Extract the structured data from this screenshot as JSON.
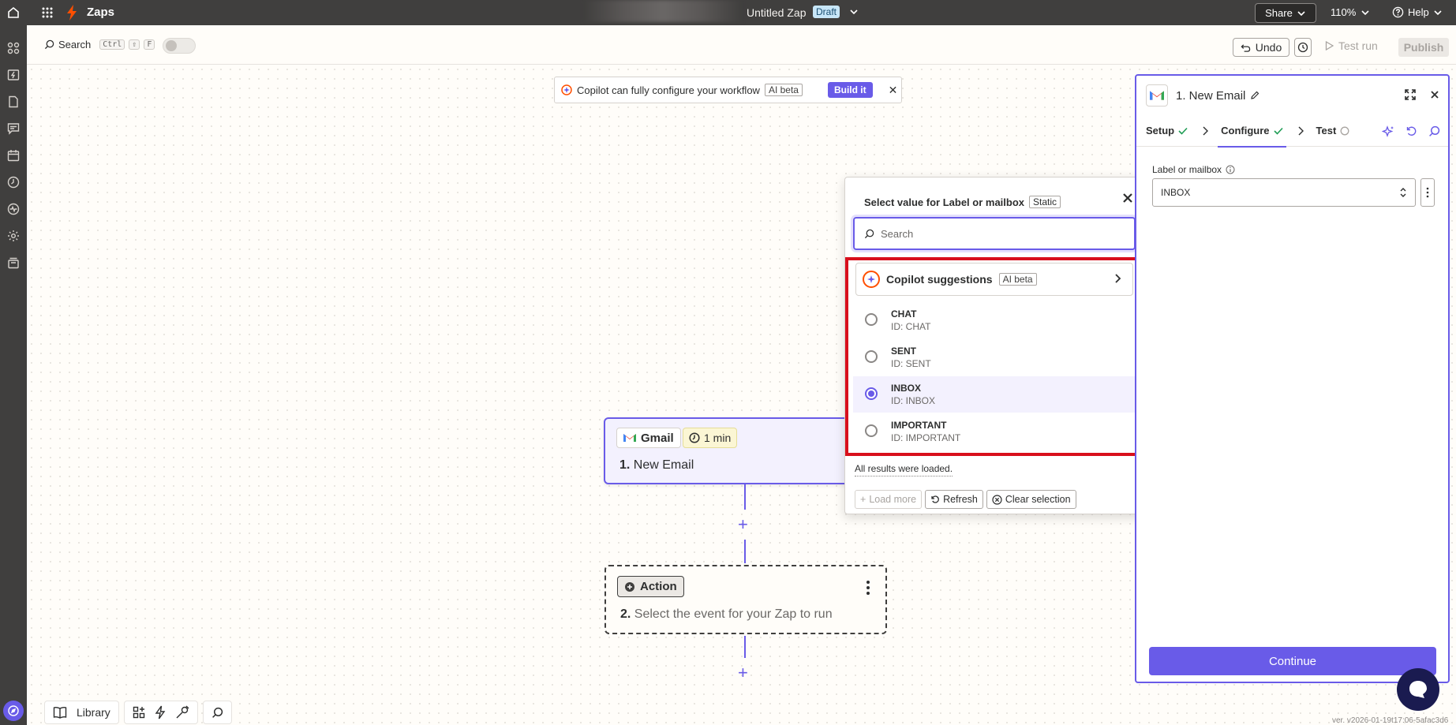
{
  "topbar": {
    "app_name": "Zaps",
    "zap_title": "Untitled Zap",
    "draft_badge": "Draft",
    "share_label": "Share",
    "zoom_label": "110%",
    "help_label": "Help"
  },
  "toolbar": {
    "search_label": "Search",
    "shortcut_keys": [
      "Ctrl",
      "⇧",
      "F"
    ],
    "undo_label": "Undo",
    "test_run_label": "Test run",
    "publish_label": "Publish"
  },
  "banner": {
    "text": "Copilot can fully configure your workflow",
    "badge": "AI beta",
    "build_label": "Build it"
  },
  "trigger_node": {
    "app": "Gmail",
    "interval": "1 min",
    "step_num": "1.",
    "title": "New Email"
  },
  "action_node": {
    "badge": "Action",
    "step_num": "2.",
    "title": "Select the event for your Zap to run"
  },
  "popup": {
    "title": "Select value for Label or mailbox",
    "static_badge": "Static",
    "search_placeholder": "Search",
    "copilot_label": "Copilot suggestions",
    "copilot_badge": "AI beta",
    "options": [
      {
        "name": "CHAT",
        "id": "ID: CHAT",
        "selected": false
      },
      {
        "name": "SENT",
        "id": "ID: SENT",
        "selected": false
      },
      {
        "name": "INBOX",
        "id": "ID: INBOX",
        "selected": true
      },
      {
        "name": "IMPORTANT",
        "id": "ID: IMPORTANT",
        "selected": false
      }
    ],
    "loaded_text": "All results were loaded.",
    "load_more_label": "Load more",
    "refresh_label": "Refresh",
    "clear_label": "Clear selection"
  },
  "panel": {
    "title": "1. New Email",
    "tabs": [
      {
        "label": "Setup",
        "status": "check"
      },
      {
        "label": "Configure",
        "status": "check"
      },
      {
        "label": "Test",
        "status": "pending"
      }
    ],
    "field_label": "Label or mailbox",
    "field_value": "INBOX",
    "continue_label": "Continue"
  },
  "bottom_bar": {
    "library_label": "Library"
  },
  "version_text": "ver. v2026-01-19t17:06-5afac3d6",
  "colors": {
    "accent": "#695be8",
    "topbar": "#403f3e",
    "highlight": "#d80f1c",
    "brand_orange": "#ff4f00"
  }
}
